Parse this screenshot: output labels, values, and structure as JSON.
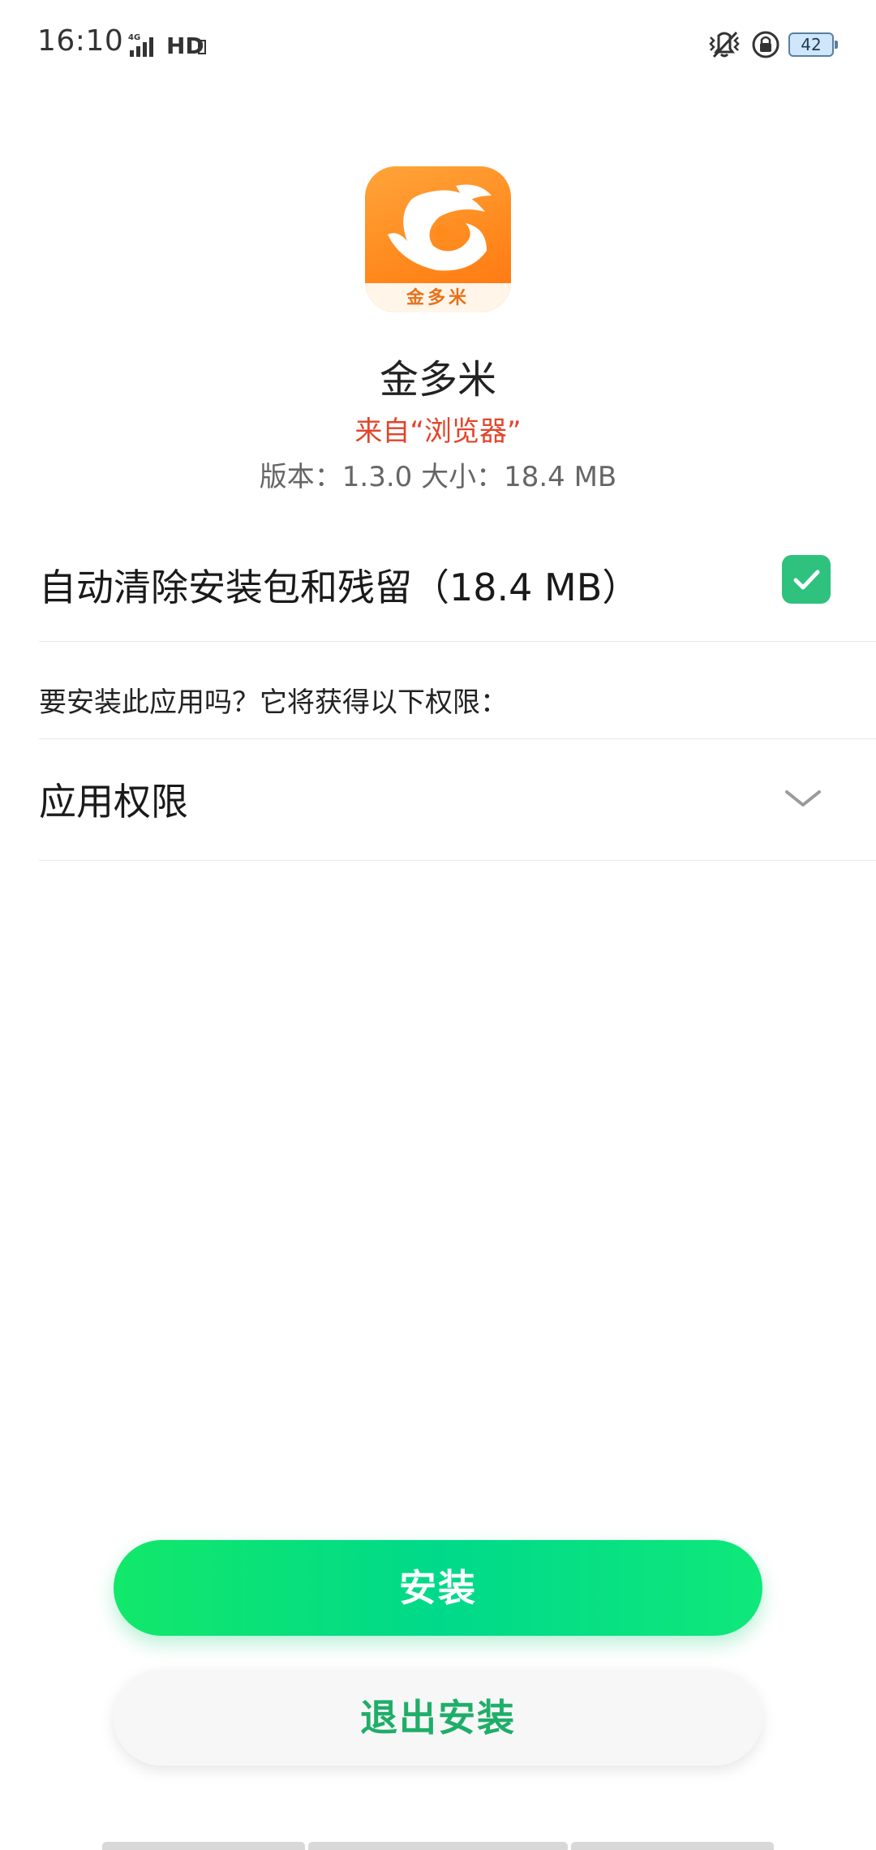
{
  "status_bar": {
    "time": "16:10",
    "network": "4G",
    "hd_label": "HD",
    "battery": "42"
  },
  "app": {
    "icon_band_text": "金多米",
    "name": "金多米",
    "source": "来自“浏览器”",
    "meta": "版本：1.3.0   大小：18.4 MB"
  },
  "options": {
    "auto_clean_label": "自动清除安装包和残留（18.4 MB）",
    "auto_clean_checked": true
  },
  "permissions": {
    "question": "要安装此应用吗？它将获得以下权限：",
    "section_label": "应用权限"
  },
  "buttons": {
    "install": "安装",
    "exit": "退出安装"
  },
  "colors": {
    "accent_green": "#1fae69",
    "install_green": "#00d98a",
    "source_red": "#e2452b",
    "icon_orange": "#ff8a1e"
  }
}
